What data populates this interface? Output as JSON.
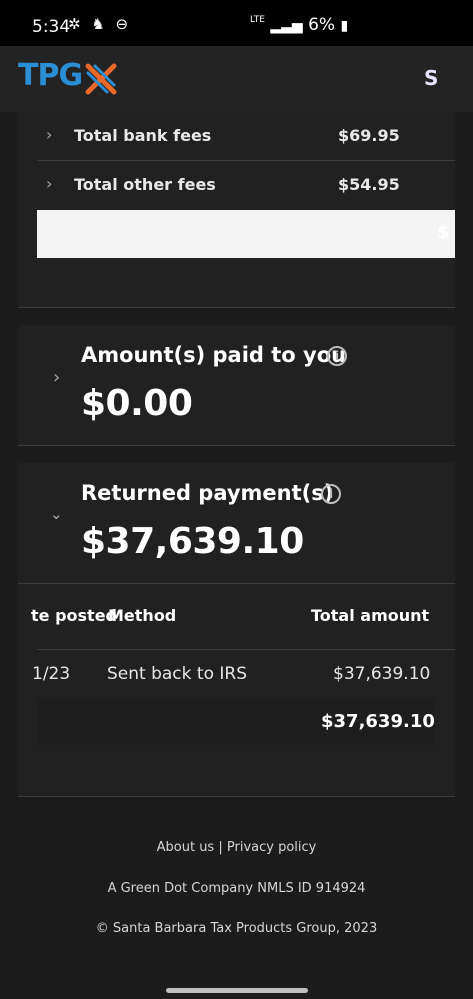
{
  "status_bar": {
    "time": "5:34",
    "network": "LTE",
    "battery": "6%"
  },
  "header": {
    "logo_text": "TPG",
    "avatar_initial": "S",
    "colors": {
      "logo_blue": "#2b8fd6",
      "logo_orange": "#e8692a"
    }
  },
  "fees": {
    "rows": [
      {
        "label": "Total bank fees",
        "value": "$69.95"
      },
      {
        "label": "Total other fees",
        "value": "$54.95"
      }
    ],
    "total_cutoff": "$"
  },
  "amount_paid": {
    "title": "Amount(s) paid to you",
    "amount": "$0.00"
  },
  "returned_payments": {
    "title": "Returned payment(s)",
    "amount": "$37,639.10",
    "table": {
      "headers": [
        "te posted",
        "Method",
        "Total amount"
      ],
      "rows": [
        {
          "date": "1/23",
          "method": "Sent back to IRS",
          "amount": "$37,639.10"
        }
      ],
      "total": "$37,639.10"
    }
  },
  "footer": {
    "about_link": "About us",
    "separator": "|",
    "privacy_link": "Privacy policy",
    "company_line": "A Green Dot Company NMLS ID 914924",
    "copyright": "© Santa Barbara Tax Products Group, 2023"
  }
}
